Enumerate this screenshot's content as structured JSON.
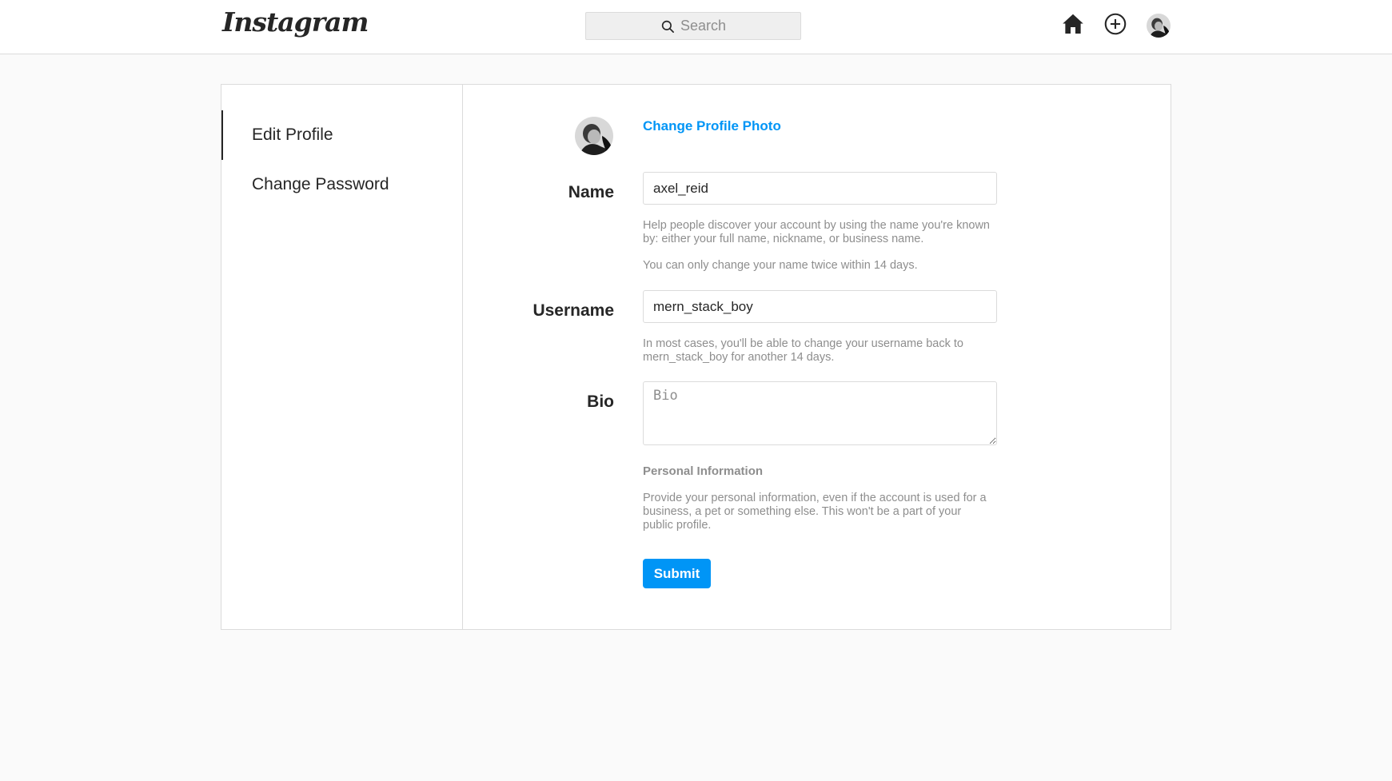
{
  "app": {
    "logo_text": "Instagram"
  },
  "topbar": {
    "search_placeholder": "Search",
    "icons": [
      "home-icon",
      "new-post-icon",
      "profile-avatar"
    ]
  },
  "sidebar": {
    "items": [
      {
        "label": "Edit Profile",
        "active": true
      },
      {
        "label": "Change Password",
        "active": false
      }
    ]
  },
  "form": {
    "change_photo_label": "Change Profile Photo",
    "name": {
      "label": "Name",
      "value": "axel_reid",
      "help_1": "Help people discover your account by using the name you're known by: either your full name, nickname, or business name.",
      "help_2": "You can only change your name twice within 14 days."
    },
    "username": {
      "label": "Username",
      "value": "mern_stack_boy",
      "help": "In most cases, you'll be able to change your username back to mern_stack_boy for another 14 days."
    },
    "bio": {
      "label": "Bio",
      "placeholder": "Bio",
      "value": ""
    },
    "personal_info": {
      "title": "Personal Information",
      "text": "Provide your personal information, even if the account is used for a business, a pet or something else. This won't be a part of your public profile."
    },
    "submit_label": "Submit"
  },
  "colors": {
    "accent": "#0095f6",
    "border": "#dbdbdb",
    "muted_text": "#8e8e8e",
    "page_bg": "#fafafa"
  }
}
